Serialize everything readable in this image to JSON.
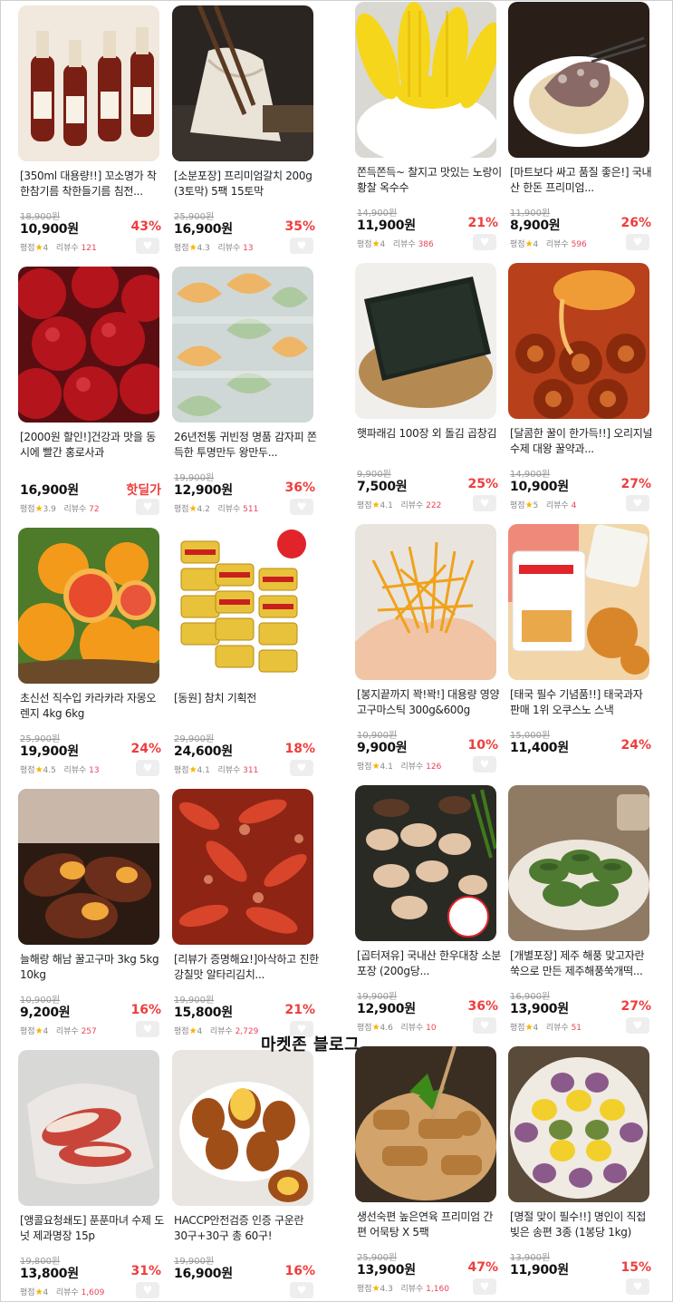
{
  "watermark": "마켓존 블로그",
  "rating_label": "평점",
  "review_label": "리뷰수",
  "products": [
    {
      "title": "[350ml 대용량!!] 꼬소명가 착한참기름 착한들기름 침전...",
      "original_price": "18,900원",
      "price": "10,900원",
      "discount": "43%",
      "rating": "4",
      "reviews": "121",
      "icon": "sesame-oil-bottles"
    },
    {
      "title": "[소분포장] 프리미엄갈치 200g (3토막) 5팩 15토막",
      "original_price": "25,900원",
      "price": "16,900원",
      "discount": "35%",
      "rating": "4.3",
      "reviews": "13",
      "icon": "grilled-hairtail"
    },
    {
      "title": "쫀득쫀득~ 찰지고 맛있는 노랑이 황찰 옥수수",
      "original_price": "14,900원",
      "price": "11,900원",
      "discount": "21%",
      "rating": "4",
      "reviews": "386",
      "icon": "corn"
    },
    {
      "title": "[마트보다 싸고 품질 좋은!] 국내산 한돈 프리미엄...",
      "original_price": "11,900원",
      "price": "8,900원",
      "discount": "26%",
      "rating": "4",
      "reviews": "596",
      "icon": "sundae-bowl"
    },
    {
      "title": "[2000원 할인!]건강과 맛을 동시에 빨간 홍로사과",
      "original_price": "",
      "price": "16,900원",
      "discount": "핫딜가",
      "rating": "3.9",
      "reviews": "72",
      "icon": "red-apples"
    },
    {
      "title": "26년전통 귀빈정 명품 감자피 쫀득한 투명만두 왕만두...",
      "original_price": "19,900원",
      "price": "12,900원",
      "discount": "36%",
      "rating": "4.2",
      "reviews": "511",
      "icon": "dumplings"
    },
    {
      "title": "햇파래김 100장 외 돌김 곱창김",
      "original_price": "9,900원",
      "price": "7,500원",
      "discount": "25%",
      "rating": "4.1",
      "reviews": "222",
      "icon": "seaweed"
    },
    {
      "title": "[달콤한 꿀이 한가득!!] 오리지널 수제 대왕 꿀약과...",
      "original_price": "14,900원",
      "price": "10,900원",
      "discount": "27%",
      "rating": "5",
      "reviews": "4",
      "icon": "honey-yakgwa"
    },
    {
      "title": "초신선 직수입 카라카라 자몽오렌지 4kg 6kg",
      "original_price": "25,900원",
      "price": "19,900원",
      "discount": "24%",
      "rating": "4.5",
      "reviews": "13",
      "icon": "oranges"
    },
    {
      "title": "[동원] 참치 기획전",
      "original_price": "29,900원",
      "price": "24,600원",
      "discount": "18%",
      "rating": "4.1",
      "reviews": "311",
      "icon": "tuna-cans"
    },
    {
      "title": "[봉지끝까지 꽉!꽉!] 대용량 영양고구마스틱 300g&600g",
      "original_price": "10,900원",
      "price": "9,900원",
      "discount": "10%",
      "rating": "4.1",
      "reviews": "126",
      "icon": "sweet-potato-sticks"
    },
    {
      "title": "[태국 필수 기념품!!] 태국과자 판매 1위 오쿠스노 스낵",
      "original_price": "15,000원",
      "price": "11,400원",
      "discount": "24%",
      "rating": "",
      "reviews": "",
      "icon": "okusno-snack"
    },
    {
      "title": "늘해랑 해남 꿀고구마 3kg 5kg 10kg",
      "original_price": "10,900원",
      "price": "9,200원",
      "discount": "16%",
      "rating": "4",
      "reviews": "257",
      "icon": "roasted-sweet-potatoes"
    },
    {
      "title": "[리뷰가 증명해요!]아삭하고 진한 강칠맛 알타리김치...",
      "original_price": "19,900원",
      "price": "15,800원",
      "discount": "21%",
      "rating": "4",
      "reviews": "2,729",
      "icon": "kimchi"
    },
    {
      "title": "[곱터져유] 국내산 한우대창 소분포장 (200g당...",
      "original_price": "19,900원",
      "price": "12,900원",
      "discount": "36%",
      "rating": "4.6",
      "reviews": "10",
      "icon": "beef-intestine"
    },
    {
      "title": "[개별포장] 제주 해풍 맞고자란 쑥으로 만든 제주해풍쑥개떡...",
      "original_price": "16,900원",
      "price": "13,900원",
      "discount": "27%",
      "rating": "4",
      "reviews": "51",
      "icon": "mugwort-rice-cake"
    },
    {
      "title": "[앵콜요청쇄도] 푼푼마녀 수제 도넛 제과명장 15p",
      "original_price": "19,800원",
      "price": "13,800원",
      "discount": "31%",
      "rating": "4",
      "reviews": "1,609",
      "icon": "donuts"
    },
    {
      "title": "HACCP안전검증 인증 구운란 30구+30구 총 60구!",
      "original_price": "19,900원",
      "price": "16,900원",
      "discount": "16%",
      "rating": "",
      "reviews": "",
      "icon": "roasted-eggs"
    },
    {
      "title": "생선숙편 높은연육 프리미엄 간편 어묵탕 X 5팩",
      "original_price": "25,900원",
      "price": "13,900원",
      "discount": "47%",
      "rating": "4.3",
      "reviews": "1,160",
      "icon": "fish-cake"
    },
    {
      "title": "[명절 맞이 필수!!] 명인이 직접 빚은 송편 3종 (1봉당 1kg)",
      "original_price": "13,900원",
      "price": "11,900원",
      "discount": "15%",
      "rating": "",
      "reviews": "",
      "icon": "songpyeon"
    }
  ]
}
